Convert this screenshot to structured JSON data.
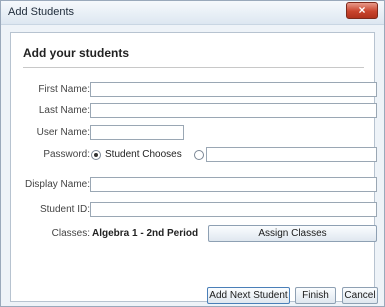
{
  "window": {
    "title": "Add Students",
    "close_glyph": "×"
  },
  "form": {
    "heading": "Add your students",
    "first_name_label": "First Name:",
    "last_name_label": "Last Name:",
    "user_name_label": "User Name:",
    "password_label": "Password:",
    "password_option_label": "Student Chooses",
    "display_name_label": "Display Name:",
    "student_id_label": "Student ID:",
    "classes_label": "Classes:",
    "classes_value": "Algebra 1 - 2nd Period",
    "first_name_value": "",
    "last_name_value": "",
    "user_name_value": "",
    "password_value": "",
    "display_name_value": "",
    "student_id_value": "",
    "password_student_chooses_selected": true
  },
  "buttons": {
    "assign_classes": "Assign Classes",
    "add_next_student": "Add Next Student",
    "finish": "Finish",
    "cancel": "Cancel"
  }
}
